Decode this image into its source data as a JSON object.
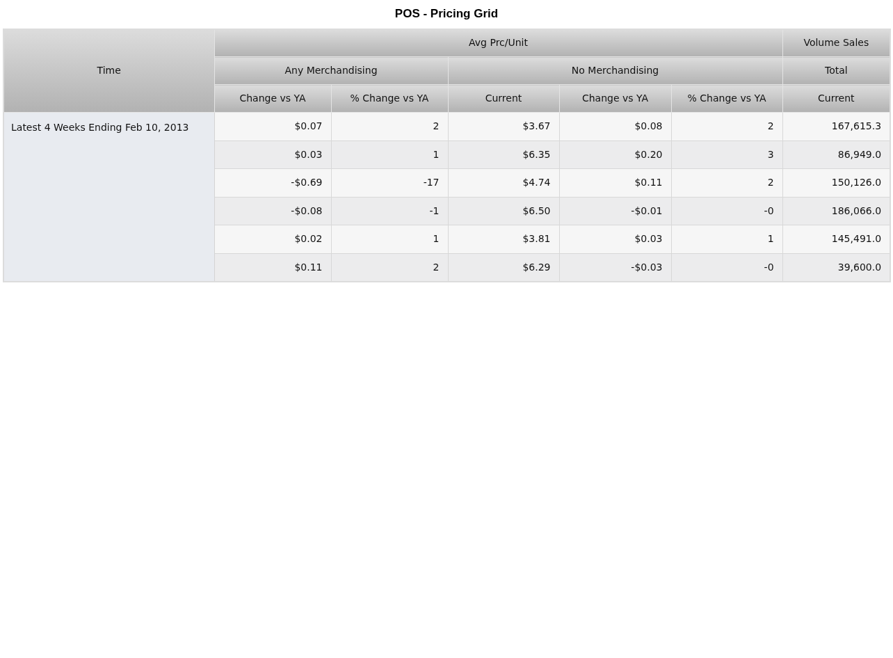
{
  "title": "POS - Pricing Grid",
  "table": {
    "corner_header": "Time",
    "column_groups": [
      {
        "label": "Avg Prc/Unit",
        "children": [
          {
            "label": "Any Merchandising",
            "columns": [
              "Change vs YA",
              "% Change vs YA"
            ]
          },
          {
            "label": "No Merchandising",
            "columns": [
              "Current",
              "Change vs YA",
              "% Change vs YA"
            ]
          }
        ]
      },
      {
        "label": "Volume Sales",
        "children": [
          {
            "label": "Total",
            "columns": [
              "Current"
            ]
          }
        ]
      }
    ],
    "row_group": {
      "label": "Latest 4 Weeks Ending Feb 10, 2013",
      "rows": [
        [
          "$0.07",
          "2",
          "$3.67",
          "$0.08",
          "2",
          "167,615.3"
        ],
        [
          "$0.03",
          "1",
          "$6.35",
          "$0.20",
          "3",
          "86,949.0"
        ],
        [
          "-$0.69",
          "-17",
          "$4.74",
          "$0.11",
          "2",
          "150,126.0"
        ],
        [
          "-$0.08",
          "-1",
          "$6.50",
          "-$0.01",
          "-0",
          "186,066.0"
        ],
        [
          "$0.02",
          "1",
          "$3.81",
          "$0.03",
          "1",
          "145,491.0"
        ],
        [
          "$0.11",
          "2",
          "$6.29",
          "-$0.03",
          "-0",
          "39,600.0"
        ]
      ]
    }
  }
}
